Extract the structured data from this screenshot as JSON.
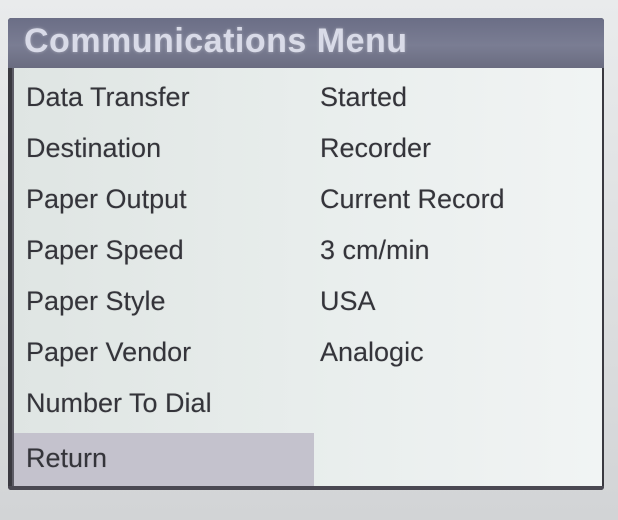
{
  "menu": {
    "title": "Communications Menu",
    "colors": {
      "title_bar": "#7a7d93",
      "title_text": "#d9dbe8",
      "panel": "#e9eeed",
      "highlight": "#c4c2cd",
      "text": "#34343a"
    },
    "items": [
      {
        "label": "Data Transfer",
        "value": "Started"
      },
      {
        "label": "Destination",
        "value": "Recorder"
      },
      {
        "label": "Paper Output",
        "value": "Current Record"
      },
      {
        "label": "Paper Speed",
        "value": "3 cm/min"
      },
      {
        "label": "Paper Style",
        "value": "USA"
      },
      {
        "label": "Paper Vendor",
        "value": "Analogic"
      },
      {
        "label": "Number To Dial",
        "value": ""
      }
    ],
    "return_label": "Return"
  }
}
